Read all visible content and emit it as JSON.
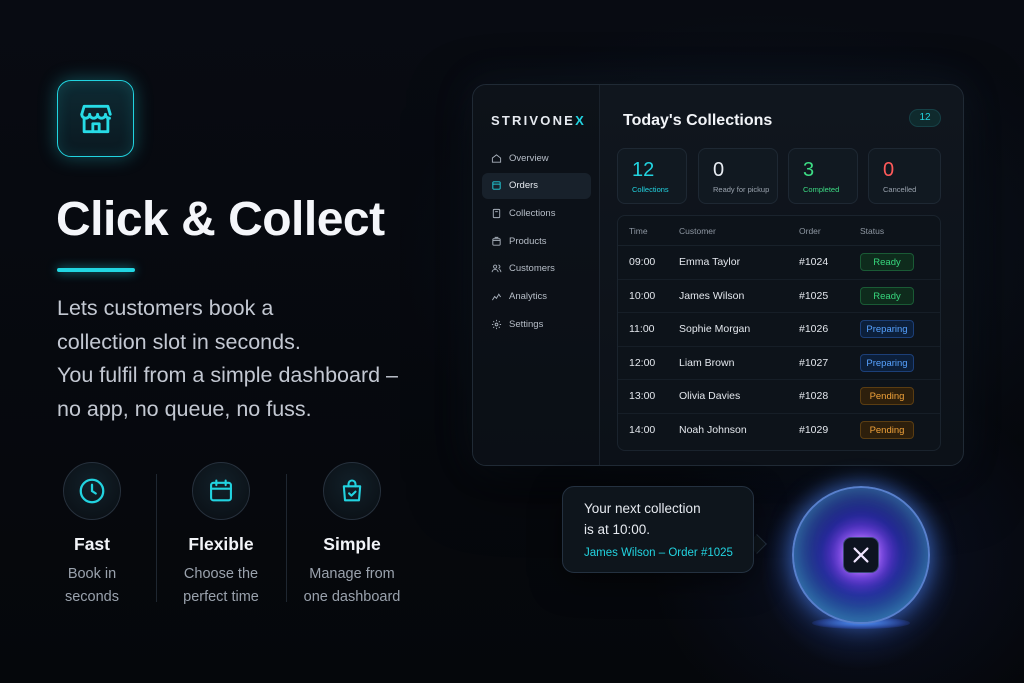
{
  "hero": {
    "title": "Click & Collect",
    "description_lines": [
      "Lets customers book a",
      "collection slot in seconds.",
      "You fulfil from a simple dashboard –",
      "no app, no queue, no fuss."
    ],
    "logo_icon": "storefront-icon"
  },
  "features": [
    {
      "icon": "clock-icon",
      "title": "Fast",
      "sub": [
        "Book in",
        "seconds"
      ]
    },
    {
      "icon": "calendar-icon",
      "title": "Flexible",
      "sub": [
        "Choose the",
        "perfect time"
      ]
    },
    {
      "icon": "shopping-bag-icon",
      "title": "Simple",
      "sub": [
        "Manage from",
        "one dashboard"
      ]
    }
  ],
  "dashboard": {
    "brand": "STRIVONE",
    "brand_accent": "X",
    "nav": [
      {
        "label": "Overview",
        "icon": "home-icon",
        "active": false
      },
      {
        "label": "Orders",
        "icon": "orders-icon",
        "active": true
      },
      {
        "label": "Collections",
        "icon": "collections-icon",
        "active": false
      },
      {
        "label": "Products",
        "icon": "box-icon",
        "active": false
      },
      {
        "label": "Customers",
        "icon": "users-icon",
        "active": false
      },
      {
        "label": "Analytics",
        "icon": "analytics-icon",
        "active": false
      },
      {
        "label": "Settings",
        "icon": "gear-icon",
        "active": false
      }
    ],
    "title": "Today's Collections",
    "count": "12",
    "stats": [
      {
        "num": "12",
        "label": "Collections",
        "color": "#22d3e0"
      },
      {
        "num": "0",
        "label": "Ready for pickup",
        "color": "#f2f4f8"
      },
      {
        "num": "3",
        "label": "Completed",
        "color": "#3ddc84"
      },
      {
        "num": "0",
        "label": "Cancelled",
        "color": "#ff5a5a"
      }
    ],
    "table": {
      "headers": {
        "time": "Time",
        "customer": "Customer",
        "order": "Order",
        "status": "Status"
      },
      "rows": [
        {
          "time": "09:00",
          "customer": "Emma Taylor",
          "order": "#1024",
          "status": "Ready",
          "kind": "ready"
        },
        {
          "time": "10:00",
          "customer": "James Wilson",
          "order": "#1025",
          "status": "Ready",
          "kind": "ready"
        },
        {
          "time": "11:00",
          "customer": "Sophie Morgan",
          "order": "#1026",
          "status": "Preparing",
          "kind": "preparing"
        },
        {
          "time": "12:00",
          "customer": "Liam Brown",
          "order": "#1027",
          "status": "Preparing",
          "kind": "preparing"
        },
        {
          "time": "13:00",
          "customer": "Olivia Davies",
          "order": "#1028",
          "status": "Pending",
          "kind": "pending"
        },
        {
          "time": "14:00",
          "customer": "Noah Johnson",
          "order": "#1029",
          "status": "Pending",
          "kind": "pending"
        }
      ]
    }
  },
  "bubble": {
    "line1": "Your next collection",
    "line2": "is at 10:00.",
    "line3": "James Wilson – Order #1025"
  },
  "orb": {
    "icon": "x-logo-icon"
  },
  "colors": {
    "accent": "#22d3e0",
    "ready": "#37d77d",
    "preparing": "#57a2ff",
    "pending": "#f0a23a"
  }
}
